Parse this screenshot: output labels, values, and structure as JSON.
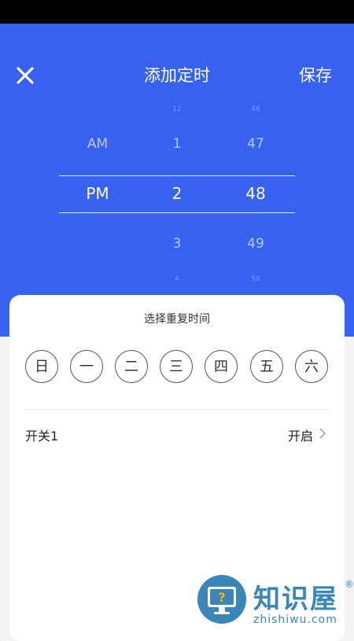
{
  "header": {
    "title": "添加定时",
    "save_label": "保存",
    "bg_color": "#3762f0"
  },
  "picker": {
    "ampm": {
      "above_near": "AM",
      "selected": "PM"
    },
    "hour": {
      "above_far": "12",
      "above_near": "1",
      "selected": "2",
      "below_near": "3",
      "below_far": "4"
    },
    "minute": {
      "above_far": "46",
      "above_near": "47",
      "selected": "48",
      "below_near": "49",
      "below_far": "50"
    }
  },
  "repeat": {
    "title": "选择重复时间",
    "days": [
      "日",
      "一",
      "二",
      "三",
      "四",
      "五",
      "六"
    ]
  },
  "switch_row": {
    "label": "开关1",
    "value": "开启"
  },
  "watermark": {
    "text": "知识屋",
    "reg": "®",
    "url": "zhishiwu.com"
  }
}
